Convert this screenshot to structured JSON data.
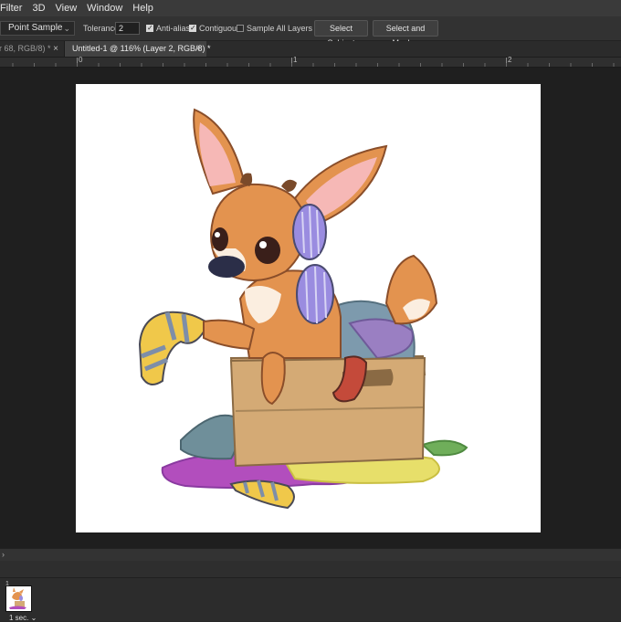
{
  "menu": [
    "Filter",
    "3D",
    "View",
    "Window",
    "Help"
  ],
  "options": {
    "sample_mode": "Point Sample",
    "tolerance_label": "Tolerance:",
    "tolerance_value": "2",
    "anti_alias": "Anti-alias",
    "anti_alias_checked": true,
    "contiguous": "Contiguous",
    "contiguous_checked": true,
    "sample_all_layers": "Sample All Layers",
    "sample_all_layers_checked": false,
    "select_subject": "Select Subject",
    "select_and_mask": "Select and Mask..."
  },
  "tabs": [
    {
      "label": "er 68, RGB/8) *",
      "active": false
    },
    {
      "label": "Untitled-1 @ 116% (Layer 2, RGB/8) *",
      "active": true
    }
  ],
  "ruler": {
    "marks": [
      "0",
      "1",
      "2"
    ]
  },
  "status": {
    "expand_icon": "chevron-right-icon"
  },
  "timeline": {
    "frame_number": "1",
    "frame_delay": "1 sec."
  },
  "colors": {
    "menubar": "#3a3a3a",
    "options_bar": "#323232",
    "workspace": "#1f1f1f",
    "canvas": "#ffffff"
  }
}
